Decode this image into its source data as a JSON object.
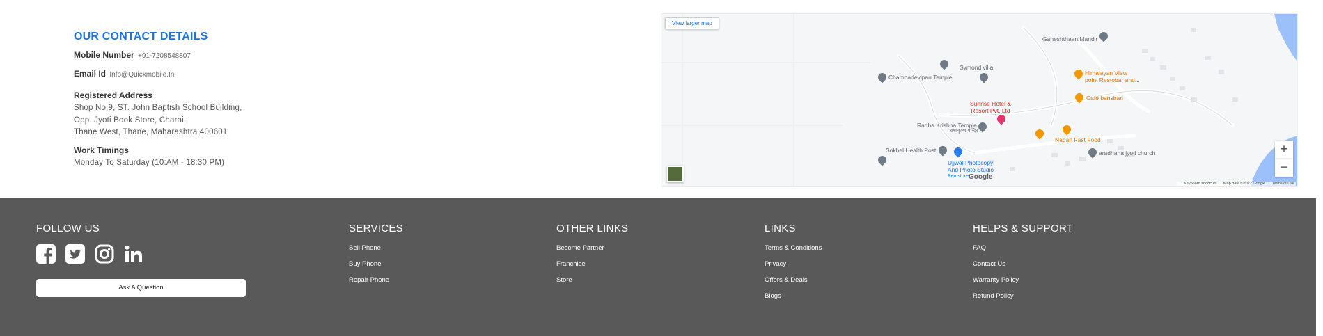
{
  "contact": {
    "title": "OUR CONTACT DETAILS",
    "mobile_label": "Mobile Number",
    "mobile_value": "+91-7208548807",
    "email_label": "Email Id",
    "email_value": "Info@Quickmobile.In",
    "address_label": "Registered Address",
    "address_line1": "Shop No.9, ST. John Baptish School Building,",
    "address_line2": "Opp. Jyoti Book Store, Charai,",
    "address_line3": "Thane West, Thane, Maharashtra 400601",
    "timings_label": "Work Timings",
    "timings_value": "Monday To Saturday (10:AM - 18:30 PM)"
  },
  "map": {
    "view_larger": "View larger map",
    "red_mark": "1",
    "places": {
      "ganeshthaan": "Ganeshthaan Mandir",
      "symond": "Symond villa",
      "champadevipau": "Champadevipau Temple",
      "himalayan1": "Himalayan View",
      "himalayan2": "point Restobar and...",
      "sunrise1": "Sunrise Hotel &",
      "sunrise2": "Resort Pvt. Ltd",
      "cafe": "Cafe bansbari",
      "radha": "Radha Krishna Temple",
      "radha_sub": "राधाकृष्ण मन्दिर",
      "nagan": "Nagan Fast Food",
      "sokhel": "Sokhel Health Post",
      "aradhana": "aradhana jyoti church",
      "ujjwal1": "Ujjwal Photocopy",
      "ujjwal2": "And Photo Studio",
      "ujjwal3": "Pen store"
    },
    "zoom_in": "+",
    "zoom_out": "−",
    "google": "Google",
    "keyboard": "Keyboard shortcuts",
    "mapdata": "Map data ©2022 Google",
    "terms": "Terms of Use"
  },
  "footer": {
    "follow_title": "FOLLOW US",
    "ask_label": "Ask A Question",
    "services_title": "SERVICES",
    "services": [
      "Sell Phone",
      "Buy Phone",
      "Repair Phone"
    ],
    "other_title": "OTHER LINKS",
    "other": [
      "Become Partner",
      "Franchise",
      "Store"
    ],
    "links_title": "LINKS",
    "links": [
      "Terms & Conditions",
      "Privacy",
      "Offers & Deals",
      "Blogs"
    ],
    "help_title": "HELPS & SUPPORT",
    "help": [
      "FAQ",
      "Contact Us",
      "Warranty Policy",
      "Refund Policy"
    ]
  }
}
